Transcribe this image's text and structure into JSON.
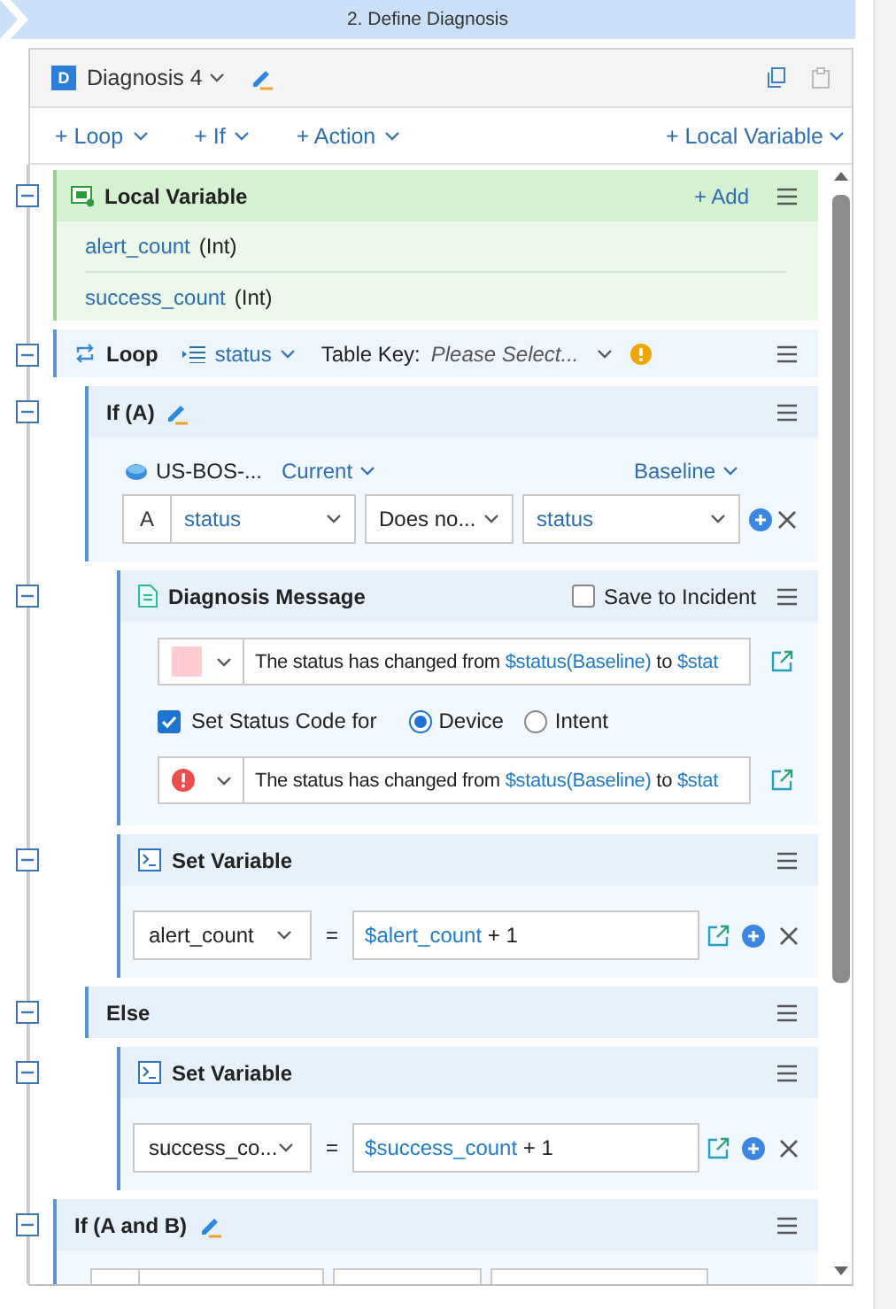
{
  "step_header": {
    "title": "2. Define Diagnosis"
  },
  "diagnosis": {
    "badge": "D",
    "name": "Diagnosis 4"
  },
  "toolbar": {
    "left": [
      {
        "label": "+ Loop"
      },
      {
        "label": "+ If"
      },
      {
        "label": "+ Action"
      }
    ],
    "right": {
      "label": "+ Local Variable"
    }
  },
  "nodes": [
    {
      "kind": "local_variable",
      "title": "Local Variable",
      "expanded": true,
      "add": "+ Add",
      "variables": [
        {
          "name": "alert_count",
          "type": "(Int)"
        },
        {
          "name": "success_count",
          "type": "(Int)"
        }
      ]
    },
    {
      "kind": "loop",
      "title": "Loop",
      "expanded": true,
      "table": "status",
      "table_key_label": "Table Key:",
      "table_key_placeholder": "Please Select...",
      "children": [
        {
          "kind": "if",
          "title": "If (A)",
          "expanded": true,
          "device": "US-BOS-...",
          "left_source": "Current",
          "right_source": "Baseline",
          "conditions": [
            {
              "letter": "A",
              "left": "status",
              "operator": "Does no...",
              "right": "status"
            }
          ],
          "children": [
            {
              "kind": "message",
              "title": "Diagnosis Message",
              "expanded": true,
              "save_label": "Save to Incident",
              "save_checked": false,
              "rows": [
                {
                  "kind": "message",
                  "selector": {
                    "kind": "color",
                    "color": "#ffccd2"
                  },
                  "parts": [
                    {
                      "text": "The status has changed from ",
                      "var": false
                    },
                    {
                      "text": "$status(Baseline)",
                      "var": true
                    },
                    {
                      "text": " to ",
                      "var": false
                    },
                    {
                      "text": "$stat",
                      "var": true
                    }
                  ]
                },
                {
                  "kind": "status_code",
                  "label": "Set Status Code for",
                  "checked": true,
                  "targets": [
                    {
                      "label": "Device",
                      "selected": true
                    },
                    {
                      "label": "Intent",
                      "selected": false
                    }
                  ]
                },
                {
                  "kind": "message",
                  "selector": {
                    "kind": "error"
                  },
                  "parts": [
                    {
                      "text": "The status has changed from ",
                      "var": false
                    },
                    {
                      "text": "$status(Baseline)",
                      "var": true
                    },
                    {
                      "text": " to ",
                      "var": false
                    },
                    {
                      "text": "$stat",
                      "var": true
                    }
                  ]
                }
              ]
            },
            {
              "kind": "set_variable",
              "title": "Set Variable",
              "expanded": true,
              "variable": "alert_count",
              "equals": "=",
              "expression": [
                {
                  "text": "$alert_count",
                  "var": true
                },
                {
                  "text": " + 1",
                  "var": false
                }
              ]
            }
          ]
        },
        {
          "kind": "else",
          "title": "Else",
          "expanded": true,
          "children": [
            {
              "kind": "set_variable",
              "title": "Set Variable",
              "expanded": true,
              "variable": "success_co...",
              "equals": "=",
              "expression": [
                {
                  "text": "$success_count",
                  "var": true
                },
                {
                  "text": " + 1",
                  "var": false
                }
              ]
            }
          ]
        }
      ]
    },
    {
      "kind": "if",
      "title": "If (A and B)",
      "expanded": true
    }
  ]
}
